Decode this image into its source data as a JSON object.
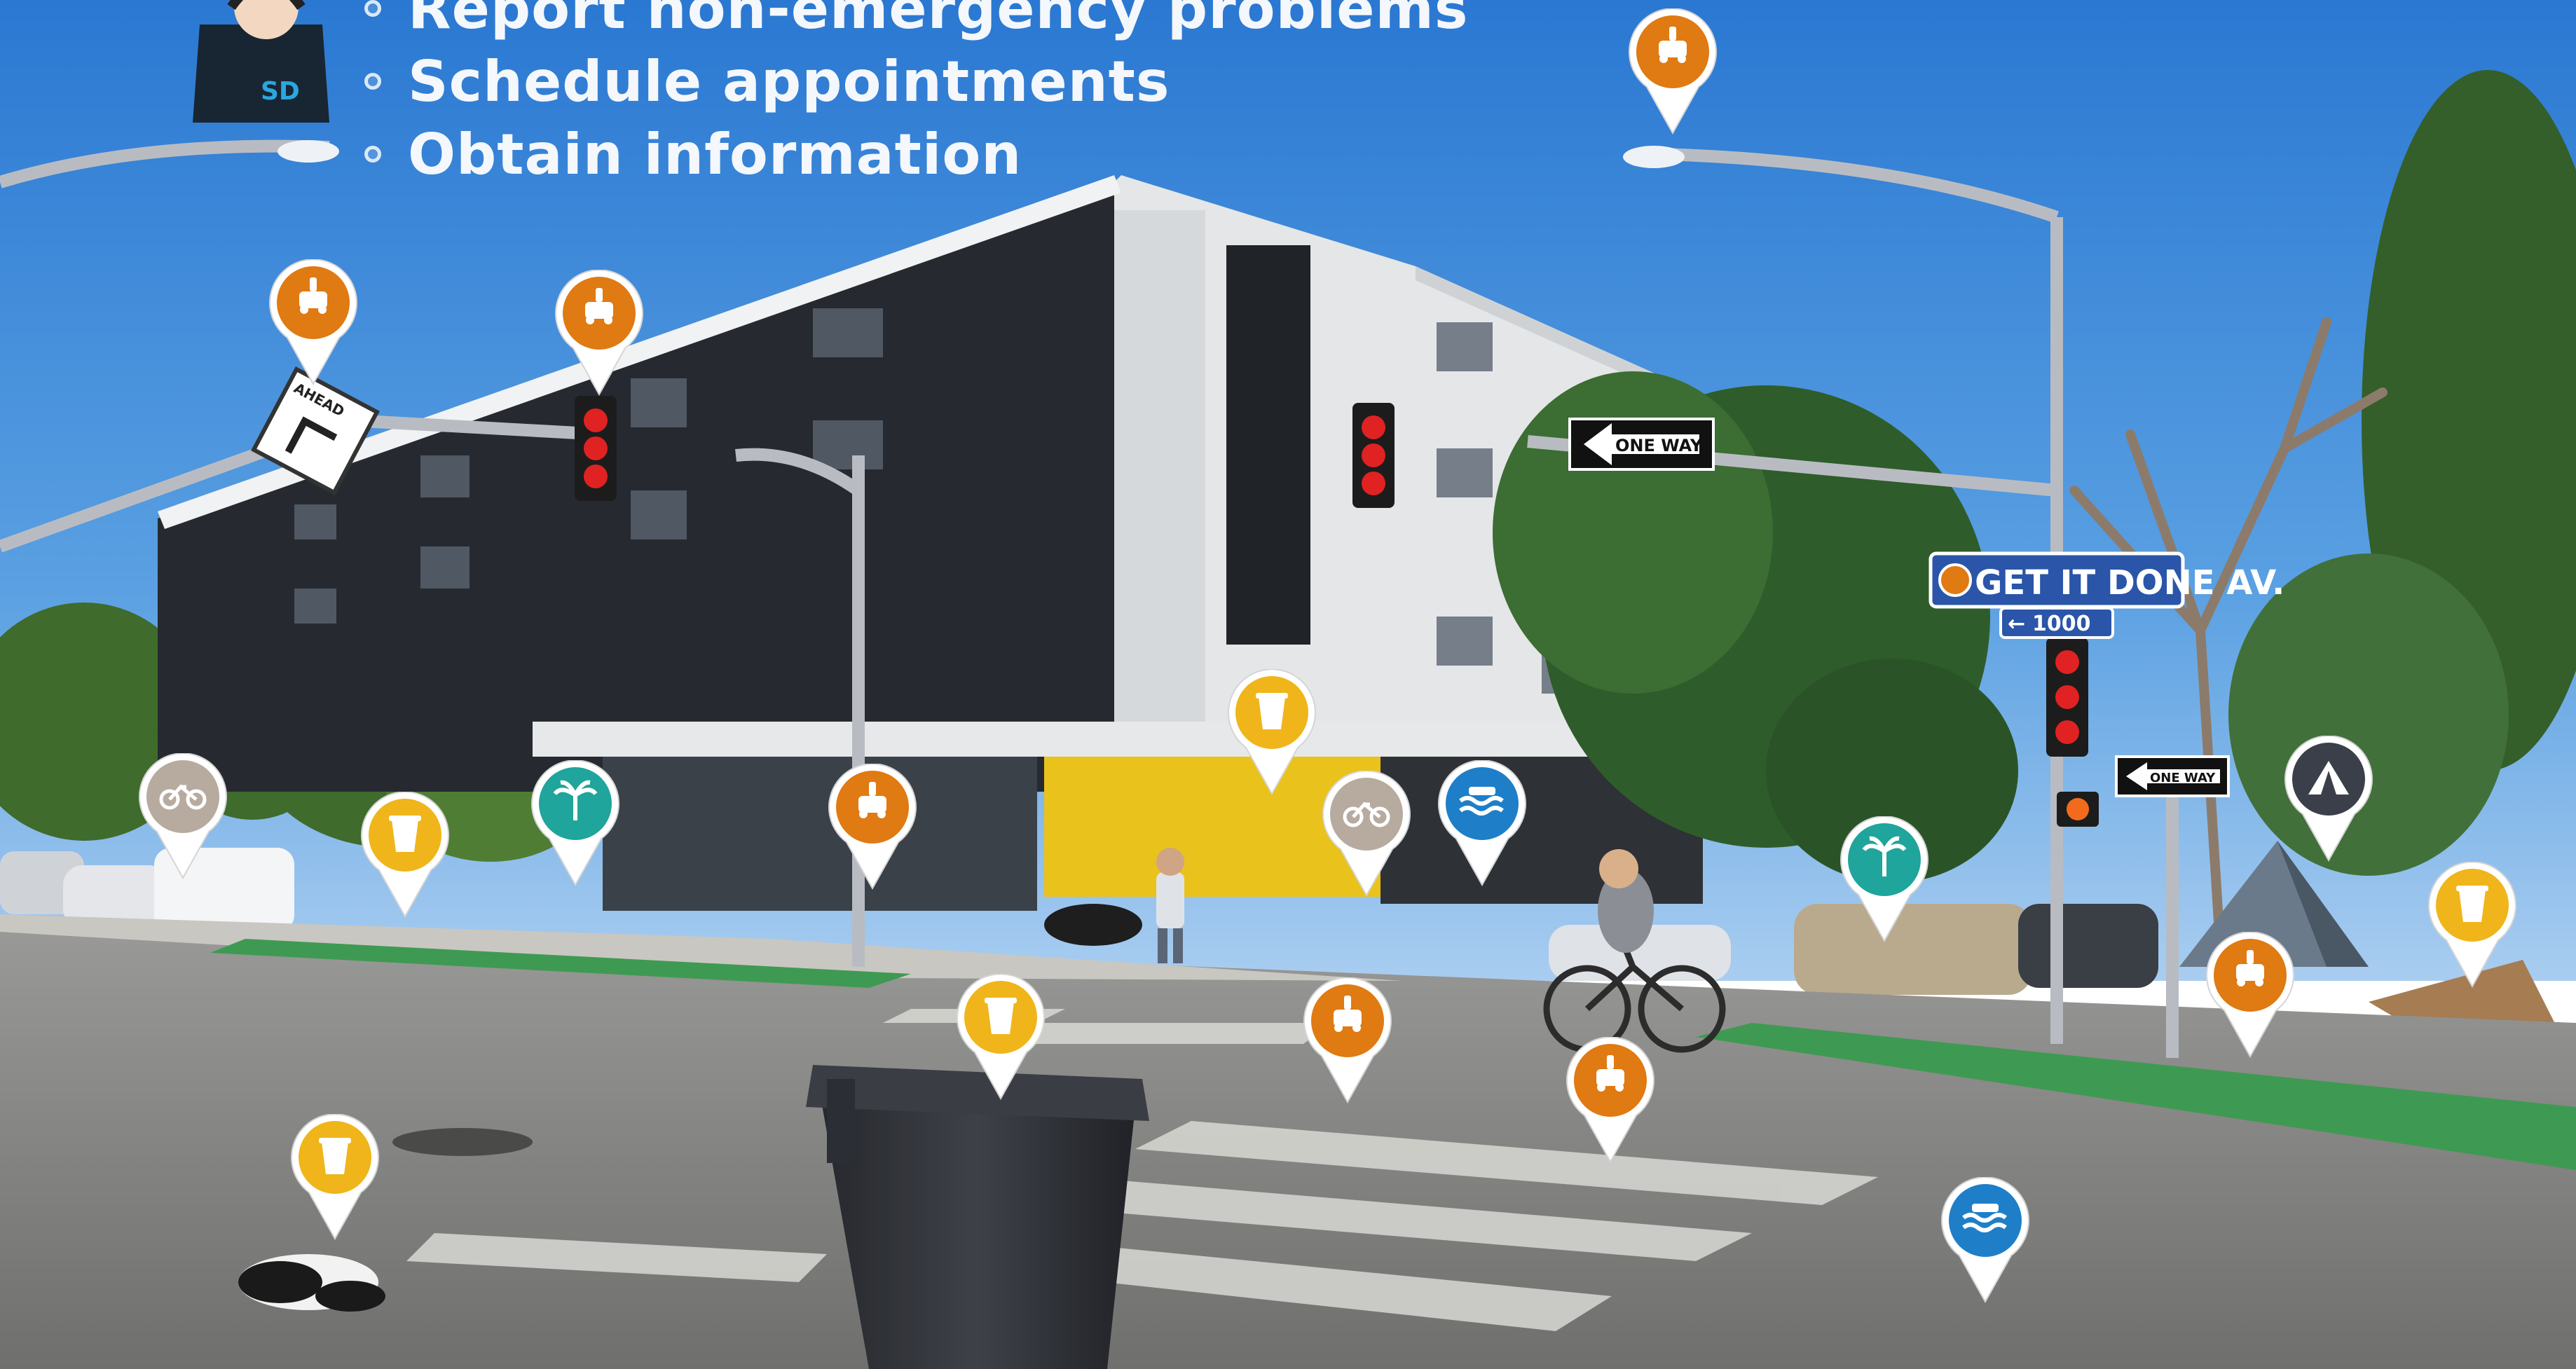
{
  "bullets": [
    "Report non-emergency problems",
    "Schedule appointments",
    "Obtain information"
  ],
  "logo_text": "SD",
  "signs": {
    "street_name": "GET IT DONE AV.",
    "block_number": "1000",
    "one_way_top": "ONE WAY",
    "one_way_right": "ONE WAY",
    "ahead_sign": "AHEAD"
  },
  "pin_icons": {
    "roadwork": "traffic-signal-repair-icon",
    "dumping": "illegal-dumping-icon",
    "parks": "parks-palm-tree-icon",
    "water": "storm-water-icon",
    "bike": "bike-lane-icon",
    "encampment": "encampment-tent-icon"
  },
  "colors": {
    "sky": "#2f7fd6",
    "pin_orange": "#e07a12",
    "pin_yellow": "#f0b51b",
    "pin_teal": "#1fa59b",
    "pin_blue": "#1e7fc8",
    "pin_grey": "#b7aba0",
    "pin_dark": "#3a3f4a",
    "street_sign": "#2a55a8",
    "bike_lane": "#3e9a52"
  }
}
